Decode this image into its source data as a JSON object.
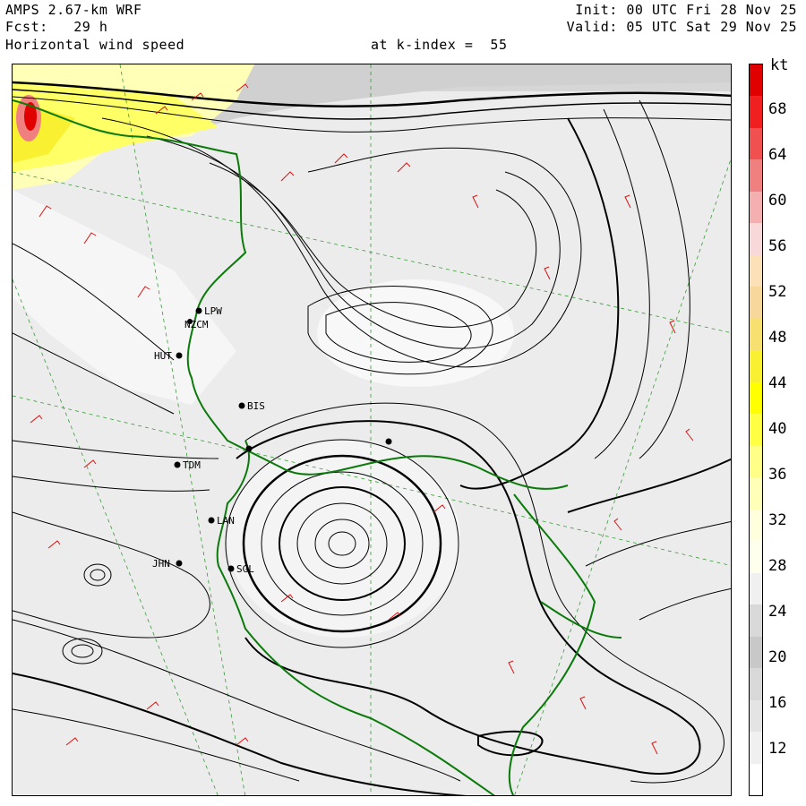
{
  "header": {
    "model": "AMPS 2.67-km WRF",
    "forecast": "Fcst:   29 h",
    "field": "Horizontal wind speed",
    "level": "at k-index =  55",
    "init": "Init: 00 UTC Fri 28 Nov 25",
    "valid": "Valid: 05 UTC Sat 29 Nov 25"
  },
  "colorbar": {
    "unit": "kt",
    "labels": [
      "68",
      "64",
      "60",
      "56",
      "52",
      "48",
      "44",
      "40",
      "36",
      "32",
      "28",
      "24",
      "20",
      "16",
      "12"
    ],
    "colors": [
      "#e00000",
      "#f02020",
      "#f05050",
      "#f08080",
      "#f4b0b0",
      "#f8d8d8",
      "#fbe0b8",
      "#f8d89a",
      "#f8e070",
      "#f8f030",
      "#ffff00",
      "#ffff44",
      "#ffff88",
      "#ffffb8",
      "#ffffdd",
      "#ffffee",
      "#f0f0f0",
      "#d8d8d8",
      "#c8c8c8",
      "#d8d8d8",
      "#e4e4e4",
      "#f0f0f0",
      "#ffffff"
    ]
  },
  "stations": [
    {
      "label": "LPW"
    },
    {
      "label": "NZCM"
    },
    {
      "label": "HUT"
    },
    {
      "label": "BIS"
    },
    {
      "label": "TDM"
    },
    {
      "label": "LAN"
    },
    {
      "label": "JHN"
    },
    {
      "label": "SGL"
    },
    {
      "label": ""
    },
    {
      "label": ""
    }
  ]
}
